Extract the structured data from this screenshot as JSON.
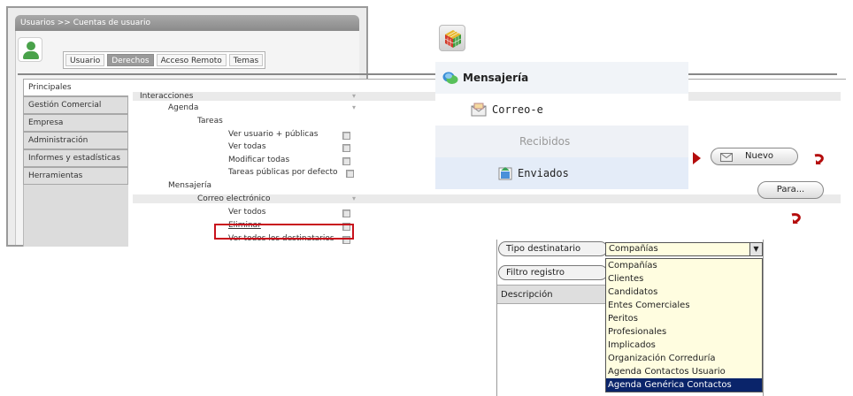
{
  "left": {
    "breadcrumb": "Usuarios >> Cuentas de usuario",
    "tabs": [
      "Usuario",
      "Derechos",
      "Acceso Remoto",
      "Temas"
    ],
    "menu": [
      "Principales",
      "Gestión Comercial",
      "Empresa",
      "Administración",
      "Informes y estadísticas",
      "Herramientas"
    ],
    "perms": {
      "interacciones": "Interacciones",
      "agenda": "Agenda",
      "tareas": "Tareas",
      "ver_usuario_publicas": "Ver usuario + públicas",
      "ver_todas": "Ver todas",
      "modificar_todas": "Modificar todas",
      "tareas_publicas": "Tareas públicas por defecto",
      "mensajeria": "Mensajería",
      "correo_electronico": "Correo electrónico",
      "ver_todos": "Ver todos",
      "eliminar": "Eliminar",
      "ver_todos_destinatarios": "Ver todos los destinatarios"
    }
  },
  "nav": {
    "mensajeria": "Mensajería",
    "correo": "Correo-e",
    "recibidos": "Recibidos",
    "enviados": "Enviados"
  },
  "buttons": {
    "nuevo": "Nuevo",
    "para": "Para..."
  },
  "form": {
    "tipo_destinatario_label": "Tipo destinatario",
    "filtro_registro_label": "Filtro registro",
    "descripcion_header": "Descripción",
    "selected_value": "Compañías",
    "options": [
      "Compañías",
      "Clientes",
      "Candidatos",
      "Entes Comerciales",
      "Peritos",
      "Profesionales",
      "Implicados",
      "Organización Correduría",
      "Agenda Contactos Usuario",
      "Agenda Genérica Contactos"
    ],
    "highlighted_option": "Agenda Genérica Contactos"
  },
  "colors": {
    "accent_red": "#c8121c",
    "selection_blue": "#0a246a",
    "dropdown_bg": "#fffde0"
  }
}
